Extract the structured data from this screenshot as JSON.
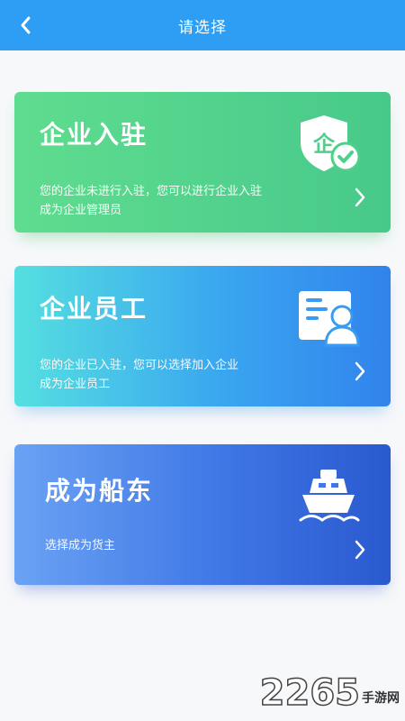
{
  "header": {
    "title": "请选择"
  },
  "cards": [
    {
      "title": "企业入驻",
      "desc": [
        "您的企业未进行入驻，您可以进行企业入驻",
        "成为企业管理员"
      ],
      "icon": "enterprise-shield-check-icon"
    },
    {
      "title": "企业员工",
      "desc": [
        "您的企业已入驻，您可以选择加入企业",
        "成为企业员工"
      ],
      "icon": "employee-card-icon"
    },
    {
      "title": "成为船东",
      "desc": [
        "选择成为货主"
      ],
      "icon": "ship-icon"
    }
  ],
  "watermark": {
    "number": "2265",
    "text": "手游网"
  },
  "colors": {
    "topbar": "#2d9ef3",
    "card1": "#4fd08a",
    "card2": "#3aa6f0",
    "card3": "#3f77e6"
  }
}
